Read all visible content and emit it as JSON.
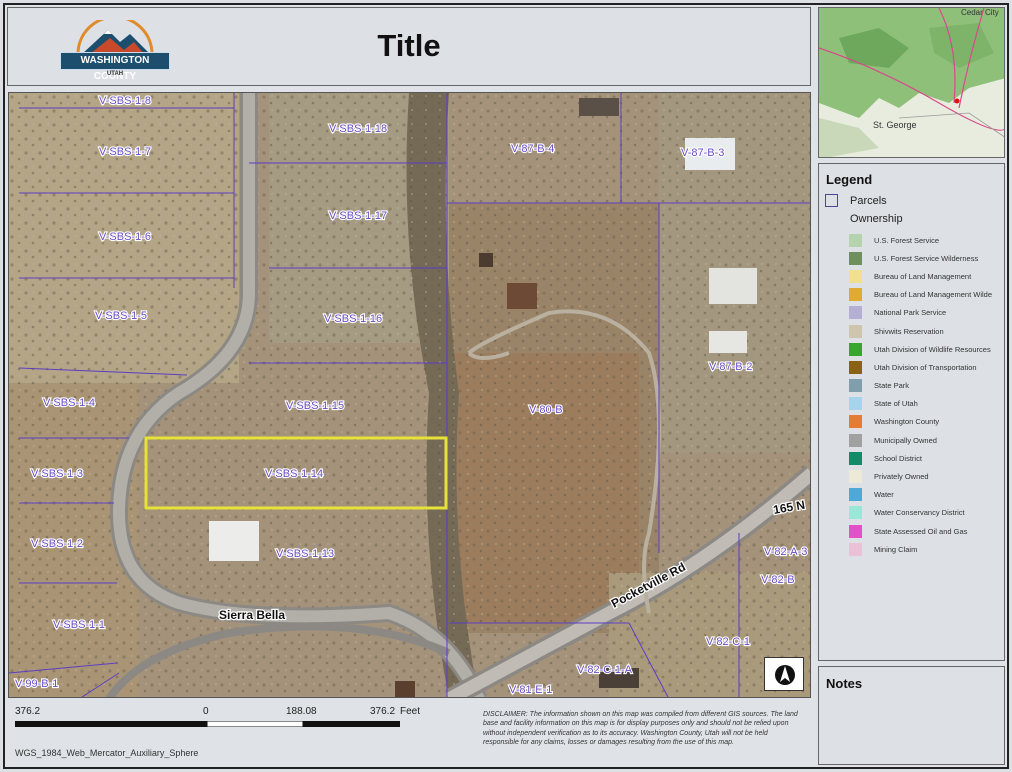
{
  "title": "Title",
  "logo": {
    "name": "WASHINGTON COUNTY",
    "state": "UTAH"
  },
  "locator_map": {
    "labels": [
      "Cedar City",
      "St. George"
    ]
  },
  "legend": {
    "heading": "Legend",
    "parcels_label": "Parcels",
    "ownership_label": "Ownership",
    "items": [
      {
        "label": "U.S. Forest Service",
        "color": "#b5d3ae"
      },
      {
        "label": "U.S. Forest Service Wilderness",
        "color": "#6f8f5f"
      },
      {
        "label": "Bureau of Land Management",
        "color": "#efdf8f"
      },
      {
        "label": "Bureau of Land Management Wilde",
        "color": "#e0ab32"
      },
      {
        "label": "National Park Service",
        "color": "#b5b0d3"
      },
      {
        "label": "Shivwits Reservation",
        "color": "#cfc4ae"
      },
      {
        "label": "Utah Division of Wildlife Resources",
        "color": "#3aa52c"
      },
      {
        "label": "Utah Division of Transportation",
        "color": "#8a6216"
      },
      {
        "label": "State Park",
        "color": "#809eab"
      },
      {
        "label": "State of Utah",
        "color": "#a7d4ea"
      },
      {
        "label": "Washington County",
        "color": "#e47b36"
      },
      {
        "label": "Municipally Owned",
        "color": "#a1a1a1"
      },
      {
        "label": "School District",
        "color": "#148a67"
      },
      {
        "label": "Privately Owned",
        "color": "#ecead6"
      },
      {
        "label": "Water",
        "color": "#4fa8d6"
      },
      {
        "label": "Water Conservancy District",
        "color": "#9be6d6"
      },
      {
        "label": "State Assessed Oil and Gas",
        "color": "#e152c6"
      },
      {
        "label": "Mining Claim",
        "color": "#eac1d6"
      }
    ]
  },
  "notes": {
    "heading": "Notes"
  },
  "map": {
    "parcels": [
      "V-SBS-1-8",
      "V-SBS-1-7",
      "V-SBS-1-6",
      "V-SBS-1-5",
      "V-SBS-1-4",
      "V-SBS-1-3",
      "V-SBS-1-2",
      "V-SBS-1-1",
      "V-99-B-1",
      "V-SBS-1-18",
      "V-SBS-1-17",
      "V-SBS-1-16",
      "V-SBS-1-15",
      "V-SBS-1-14",
      "V-SBS-1-13",
      "V-87-B-4",
      "V-87-B-3",
      "V-87-B-2",
      "V-80-B",
      "V-82-A-3",
      "V-82-B",
      "V-82-C-1",
      "V-82-C-1-A",
      "V-81-E-1"
    ],
    "roads": [
      "Sierra Bella",
      "Pocketville Rd",
      "165 N"
    ]
  },
  "scale_bar": {
    "labels": [
      "376.2",
      "0",
      "188.08",
      "376.2"
    ],
    "unit": "Feet"
  },
  "projection": "WGS_1984_Web_Mercator_Auxiliary_Sphere",
  "disclaimer": "DISCLAIMER: The information shown on this map was compiled from different GIS sources. The land base and facility information on this map is for display purposes only and should not be relied upon without independent verification as to its accuracy. Washington County, Utah will not be held responsible for any claims, losses or damages resulting from the use of this map."
}
